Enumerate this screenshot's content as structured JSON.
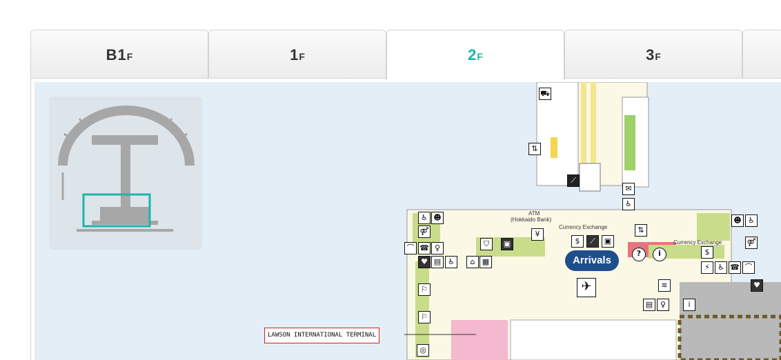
{
  "floor_tabs": [
    {
      "main": "B1",
      "suffix": "F",
      "active": false
    },
    {
      "main": "1",
      "suffix": "F",
      "active": false
    },
    {
      "main": "2",
      "suffix": "F",
      "active": true
    },
    {
      "main": "3",
      "suffix": "F",
      "active": false
    }
  ],
  "map": {
    "atm_label": "ATM",
    "atm_bank_label": "(Hokkaido Bank)",
    "currency_exchange_left": "Currency Exchange",
    "currency_exchange_right": "Currency Exchange",
    "arrivals": "Arrivals",
    "lawson_label": "LAWSON INTERNATIONAL TERMINAL"
  },
  "colors": {
    "active_tab": "#18b5ad",
    "map_background": "#e3eef6",
    "arrivals_badge": "#1f4e8c",
    "lawson_box": "#d21f24",
    "store_area": "#f4b8cf",
    "facility_green": "#c9dc8a"
  },
  "icons": [
    "escalator-icon",
    "elevator-icon",
    "mailbox-icon",
    "accessible-icon",
    "restroom-icon",
    "atm-icon",
    "currency-icon",
    "information-icon",
    "question-icon",
    "aed-icon",
    "locker-icon",
    "phone-icon",
    "airplane-arrival-icon",
    "baby-room-icon",
    "payphone-icon"
  ]
}
